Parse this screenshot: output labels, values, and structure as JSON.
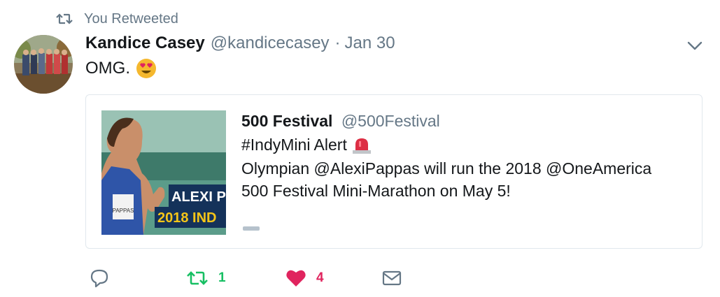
{
  "context": {
    "label": "You Retweeted",
    "icon": "retweet-icon",
    "color": "#657786"
  },
  "tweet": {
    "author_name": "Kandice Casey",
    "author_handle": "@kandicecasey",
    "separator": "·",
    "date": "Jan 30",
    "text": "OMG.",
    "emoji": "heart-eyes-emoji"
  },
  "quoted_tweet": {
    "author_name": "500 Festival",
    "author_handle": "@500Festival",
    "hashtag_line": "#IndyMini Alert",
    "alert_icon": "rotating-light-icon",
    "line2": "Olympian @AlexiPappas will run the 2018 @OneAmerica",
    "line3": "500 Festival Mini-Marathon on May 5!",
    "media": {
      "banner_text_1": "ALEXI P",
      "banner_text_2": "2018 IND",
      "bib_text": "PAPPAS"
    }
  },
  "actions": {
    "reply": {
      "icon": "reply-icon",
      "count": ""
    },
    "retweet": {
      "icon": "retweet-icon",
      "count": "1",
      "color": "#17bf63"
    },
    "like": {
      "icon": "heart-icon",
      "count": "4",
      "color": "#e0245e"
    },
    "dm": {
      "icon": "envelope-icon"
    }
  }
}
